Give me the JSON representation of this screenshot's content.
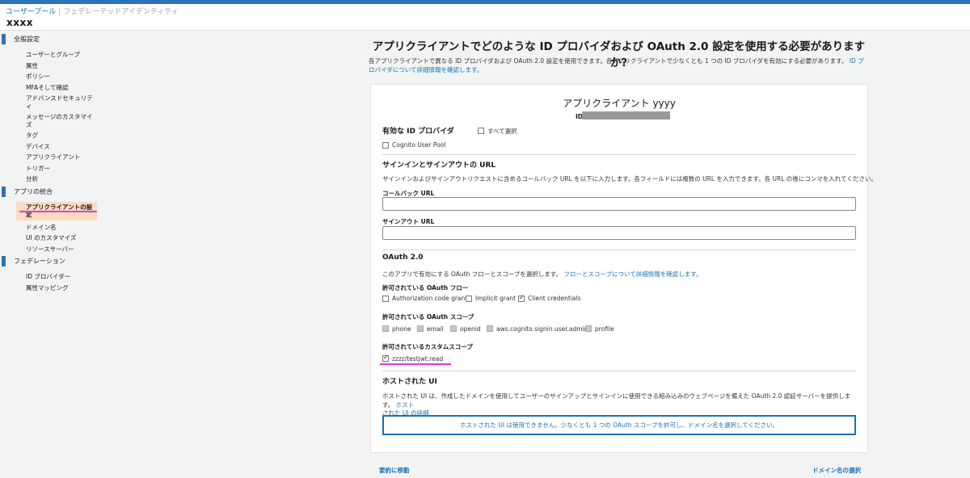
{
  "header": {
    "tab_user_pools": "ユーザープール",
    "tab_federated": "フェデレーテッドアイデンティティ",
    "pool_name": "xxxx"
  },
  "sidebar": {
    "general": {
      "title": "全般設定",
      "items": [
        "ユーザーとグループ",
        "属性",
        "ポリシー",
        "MFAそして確認",
        "アドバンスドセキュリティ",
        "メッセージのカスタマイズ",
        "タグ",
        "デバイス",
        "アプリクライアント",
        "トリガー",
        "分析"
      ]
    },
    "app_integration": {
      "title": "アプリの統合",
      "items": [
        "アプリクライアントの設定",
        "ドメイン名",
        "UI のカスタマイズ",
        "リソースサーバー"
      ]
    },
    "federation": {
      "title": "フェデレーション",
      "items": [
        "ID プロバイダー",
        "属性マッピング"
      ]
    }
  },
  "main": {
    "title": "アプリクライアントでどのような ID プロバイダおよび OAuth 2.0 設定を使用する必要がありますか?",
    "intro": "各アプリクライアントで異なる ID プロバイダおよび OAuth 2.0 設定を使用できます。各アプリクライアントで少なくとも 1 つの ID プロバイダを有効にする必要があります。",
    "intro_link": "ID プロバイダについて詳細情報を確認します。"
  },
  "card": {
    "client_name": "アプリクライアント yyyy",
    "client_id_label": "ID",
    "idp": {
      "title": "有効な ID プロバイダ",
      "select_all": "すべて選択",
      "cognito": "Cognito User Pool"
    },
    "urls": {
      "title": "サインインとサインアウトの URL",
      "desc": "サインインおよびサインアウトリクエストに含めるコールバック URL を以下に入力します。各フィールドには複数の URL を入力できます。各 URL の後にコンマを入れてください。",
      "callback_label": "コールバック URL",
      "callback_value": "",
      "signout_label": "サインアウト URL",
      "signout_value": ""
    },
    "oauth": {
      "title": "OAuth 2.0",
      "desc": "このアプリで有効にする OAuth フローとスコープを選択します。",
      "desc_link": "フローとスコープについて詳細情報を確認します。",
      "flows_title": "許可されている OAuth フロー",
      "flows": [
        {
          "label": "Authorization code grant",
          "checked": false
        },
        {
          "label": "Implicit grant",
          "checked": false
        },
        {
          "label": "Client credentials",
          "checked": true
        }
      ],
      "scopes_title": "許可されている OAuth スコープ",
      "scopes": [
        "phone",
        "email",
        "openid",
        "aws.cognito.signin.user.admin",
        "profile"
      ],
      "custom_title": "許可されているカスタムスコープ",
      "custom_scopes": [
        {
          "label": "zzzz/testjwt.read",
          "checked": true
        }
      ]
    },
    "hosted_ui": {
      "title": "ホストされた UI",
      "desc": "ホストされた UI は、作成したドメインを使用してユーザーのサインアップとサインインに使用できる組み込みのウェブページを備えた OAuth 2.0 認証サーバーを提供します。",
      "desc_link_1": "ホスト",
      "desc_link_2": "された UI の詳細",
      "alert": "ホストされた UI は使用できません。少なくとも 1 つの OAuth スコープを許可し、ドメイン名を選択してください。"
    }
  },
  "footer": {
    "summary_link": "要約に移動",
    "domain_link": "ドメイン名の選択"
  },
  "colors": {
    "accent": "#1a73b4",
    "active_bg": "#f9dcc2",
    "highlight": "#ea36d8"
  }
}
